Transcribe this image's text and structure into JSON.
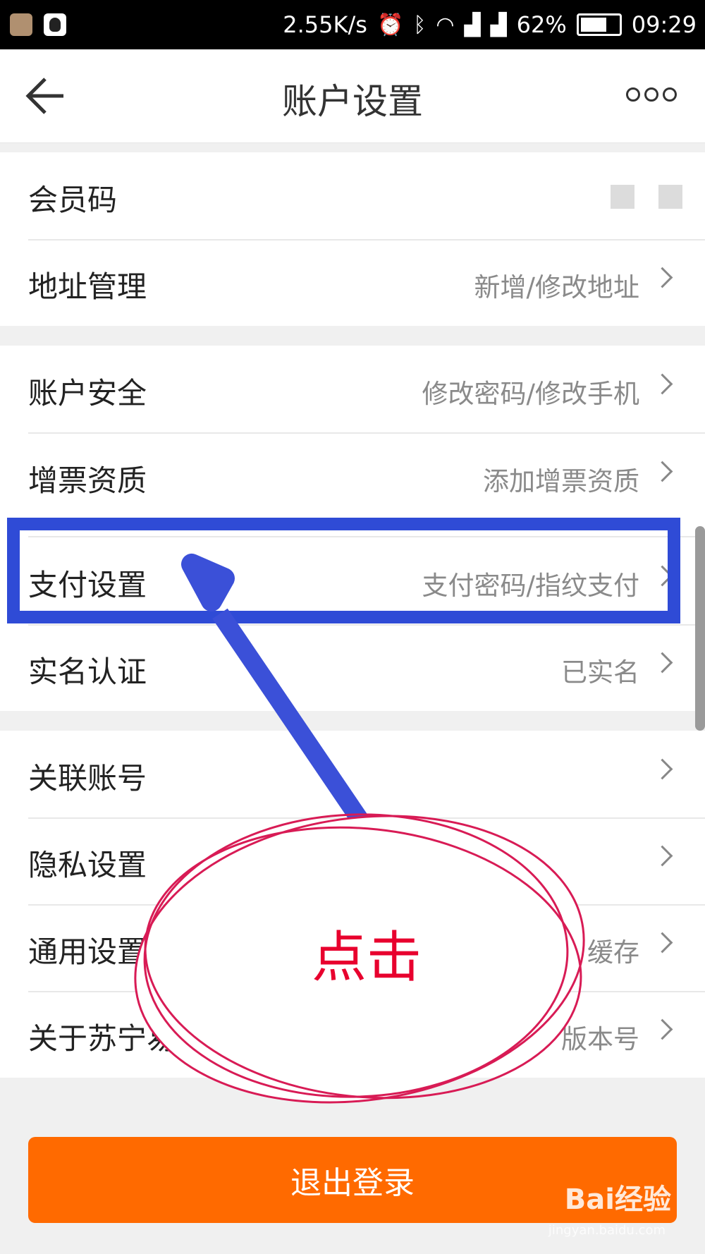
{
  "status_bar": {
    "speed": "2.55K/s",
    "battery": "62%",
    "time": "09:29"
  },
  "header": {
    "title": "账户设置"
  },
  "section1": [
    {
      "label": "会员码",
      "value": ""
    },
    {
      "label": "地址管理",
      "value": "新增/修改地址"
    }
  ],
  "section2": [
    {
      "label": "账户安全",
      "value": "修改密码/修改手机"
    },
    {
      "label": "增票资质",
      "value": "添加增票资质"
    },
    {
      "label": "支付设置",
      "value": "支付密码/指纹支付"
    },
    {
      "label": "实名认证",
      "value": "已实名"
    }
  ],
  "section3": [
    {
      "label": "关联账号",
      "value": ""
    },
    {
      "label": "隐私设置",
      "value": ""
    },
    {
      "label": "通用设置",
      "value": "缓存"
    },
    {
      "label": "关于苏宁易购",
      "value": "版本号"
    }
  ],
  "logout_label": "退出登录",
  "annotation_text": "点击",
  "watermark": "Bai经验",
  "watermark_url": "jingyan.baidu.com"
}
